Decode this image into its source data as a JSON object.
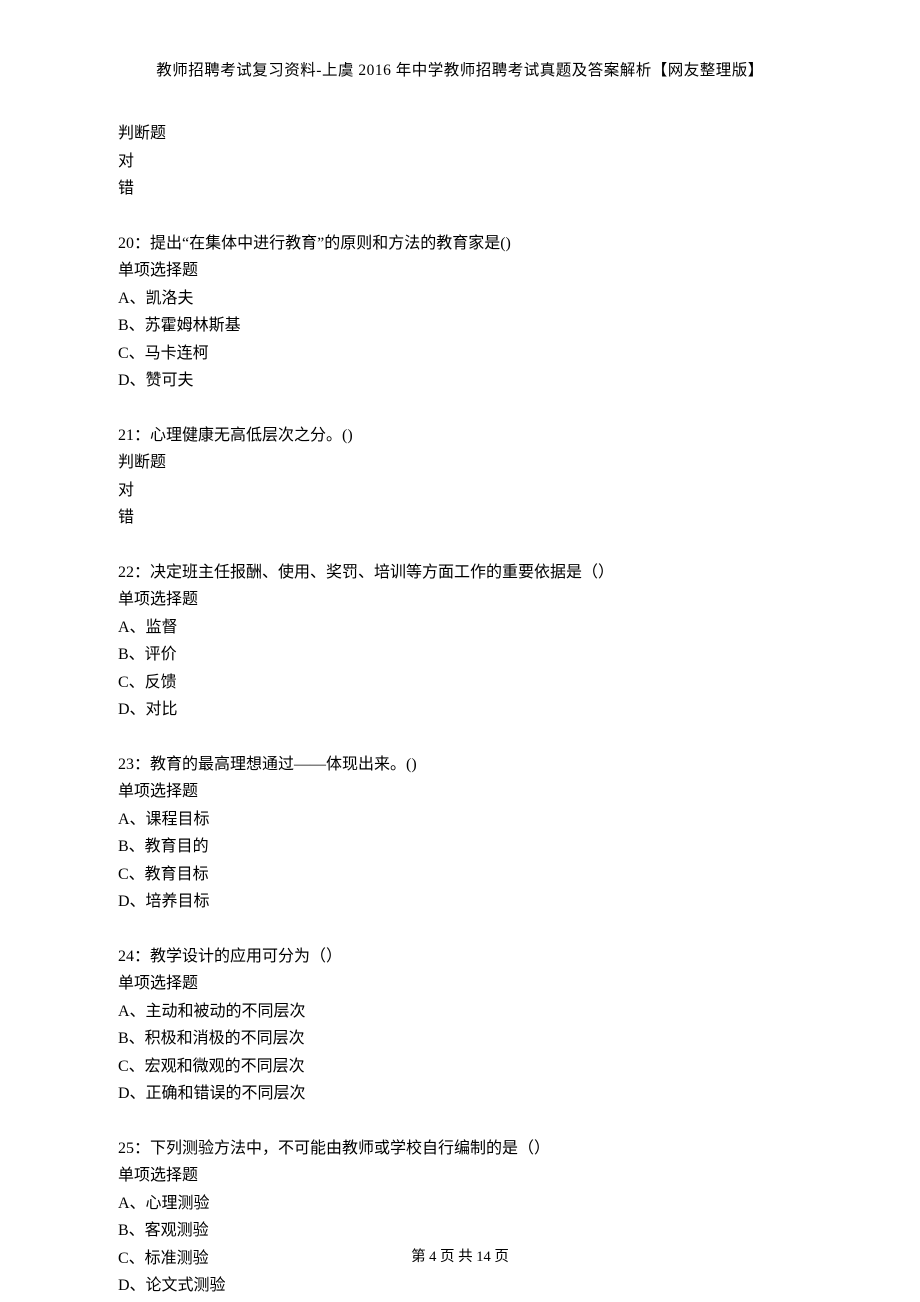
{
  "header": "教师招聘考试复习资料-上虞 2016 年中学教师招聘考试真题及答案解析【网友整理版】",
  "q19_tail": {
    "type": "判断题",
    "opts": [
      "对",
      "错"
    ]
  },
  "q20": {
    "stem": "20：提出“在集体中进行教育”的原则和方法的教育家是()",
    "type": "单项选择题",
    "opts": [
      "A、凯洛夫",
      "B、苏霍姆林斯基",
      "C、马卡连柯",
      "D、赞可夫"
    ]
  },
  "q21": {
    "stem": "21：心理健康无高低层次之分。()",
    "type": "判断题",
    "opts": [
      "对",
      "错"
    ]
  },
  "q22": {
    "stem": "22：决定班主任报酬、使用、奖罚、培训等方面工作的重要依据是（）",
    "type": "单项选择题",
    "opts": [
      "A、监督",
      "B、评价",
      "C、反馈",
      "D、对比"
    ]
  },
  "q23": {
    "stem": "23：教育的最高理想通过——体现出来。()",
    "type": "单项选择题",
    "opts": [
      "A、课程目标",
      "B、教育目的",
      "C、教育目标",
      "D、培养目标"
    ]
  },
  "q24": {
    "stem": "24：教学设计的应用可分为（）",
    "type": "单项选择题",
    "opts": [
      "A、主动和被动的不同层次",
      "B、积极和消极的不同层次",
      "C、宏观和微观的不同层次",
      "D、正确和错误的不同层次"
    ]
  },
  "q25": {
    "stem": "25：下列测验方法中，不可能由教师或学校自行编制的是（）",
    "type": "单项选择题",
    "opts": [
      "A、心理测验",
      "B、客观测验",
      "C、标准测验",
      "D、论文式测验"
    ]
  },
  "footer": "第 4 页 共 14 页"
}
